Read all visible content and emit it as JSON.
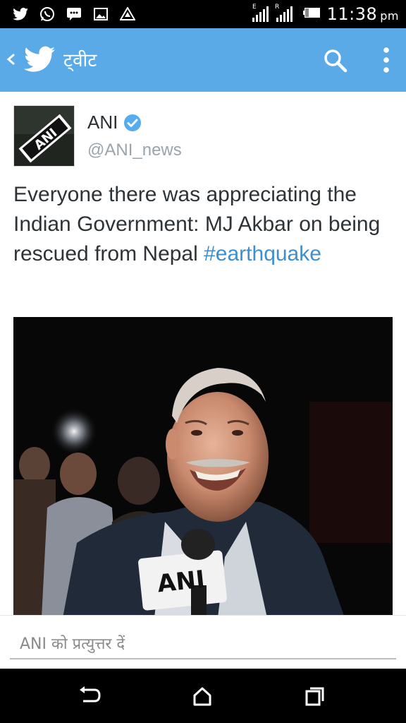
{
  "status_bar": {
    "time": "11:38",
    "ampm": "pm",
    "notification_icons": [
      "twitter-icon",
      "whatsapp-icon",
      "message-icon",
      "image-icon",
      "drive-icon"
    ],
    "network_labels": [
      "E",
      "R"
    ]
  },
  "app_bar": {
    "title": "ट्वीट",
    "color": "#5aaae8"
  },
  "tweet": {
    "author_name": "ANI",
    "handle": "@ANI_news",
    "avatar_label": "ANI",
    "text": "Everyone there was appreciating the Indian Government: MJ Akbar on being rescued from Nepal ",
    "hashtag": "#earthquake",
    "hashtag_color": "#3d8fcf",
    "photo_mic_label": "ANI"
  },
  "reply": {
    "placeholder": "ANI को प्रत्युत्तर दें"
  }
}
